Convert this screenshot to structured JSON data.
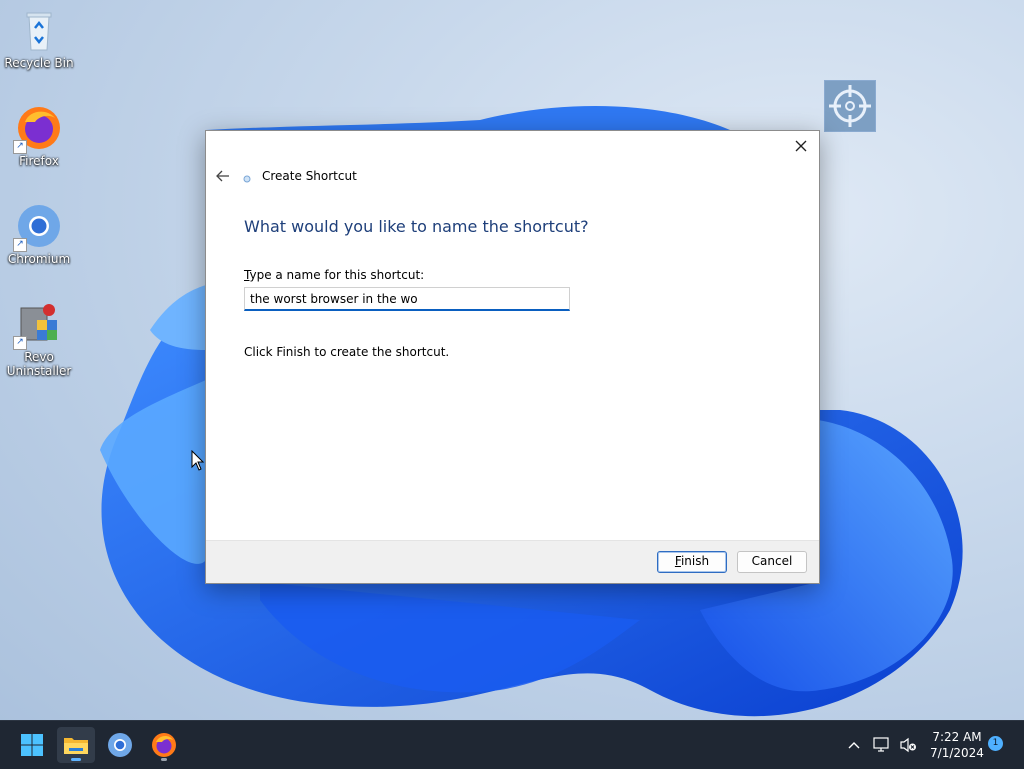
{
  "desktop": {
    "icons": [
      {
        "label": "Recycle Bin",
        "icon": "recycle-bin-icon"
      },
      {
        "label": "Firefox",
        "icon": "firefox-icon"
      },
      {
        "label": "Chromium",
        "icon": "chromium-icon"
      },
      {
        "label": "Revo\nUninstaller",
        "icon": "revo-uninstaller-icon"
      }
    ]
  },
  "dialog": {
    "title": "Create Shortcut",
    "heading": "What would you like to name the shortcut?",
    "field_label": "Type a name for this shortcut:",
    "field_value": "the worst browser in the wo",
    "hint": "Click Finish to create the shortcut.",
    "finish_label": "Finish",
    "cancel_label": "Cancel"
  },
  "taskbar": {
    "items": [
      "windows-start-icon",
      "file-explorer-icon",
      "chromium-icon",
      "firefox-icon"
    ],
    "time": "7:22 AM",
    "date": "7/1/2024",
    "notification_count": "1"
  },
  "colors": {
    "accent": "#0a5fc0",
    "heading": "#1e3f7a",
    "taskbar": "#1f2733"
  }
}
